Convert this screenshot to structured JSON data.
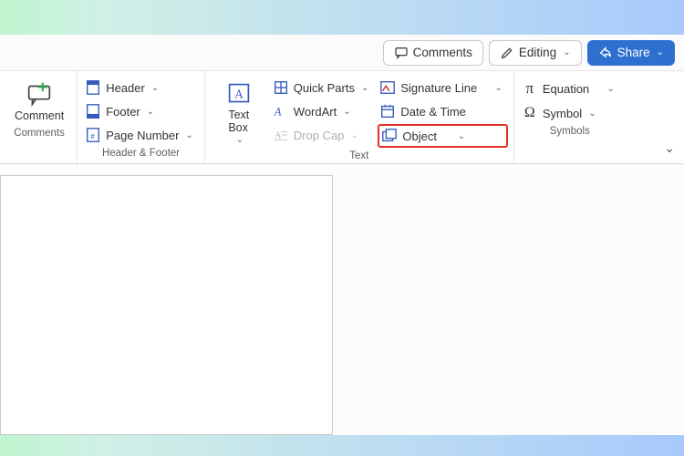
{
  "topbar": {
    "comments": "Comments",
    "editing": "Editing",
    "share": "Share"
  },
  "groups": {
    "comments": {
      "label": "Comments",
      "comment": "Comment"
    },
    "headerFooter": {
      "label": "Header & Footer",
      "header": "Header",
      "footer": "Footer",
      "pageNumber": "Page Number"
    },
    "text": {
      "label": "Text",
      "textBox": "Text\nBox",
      "quickParts": "Quick Parts",
      "wordArt": "WordArt",
      "dropCap": "Drop Cap",
      "signatureLine": "Signature Line",
      "dateTime": "Date & Time",
      "object": "Object"
    },
    "symbols": {
      "label": "Symbols",
      "equation": "Equation",
      "symbol": "Symbol"
    }
  }
}
